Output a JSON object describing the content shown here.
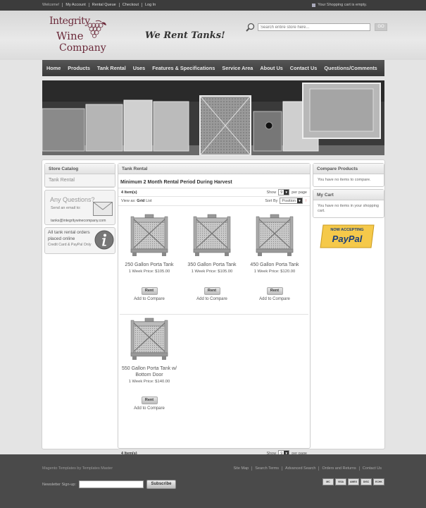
{
  "topbar": {
    "welcome": "Welcome!",
    "links": [
      "My Account",
      "Rental Queue",
      "Checkout",
      "Log In"
    ],
    "cart_status": "Your Shopping cart is empty."
  },
  "header": {
    "logo_lines": [
      "Integrity",
      "Wine",
      "Company"
    ],
    "tagline": "We Rent Tanks!",
    "search_placeholder": "Search entire store here...",
    "search_button": "GO"
  },
  "nav": {
    "items": [
      "Home",
      "Products",
      "Tank Rental",
      "Uses",
      "Features & Specifications",
      "Service Area",
      "About Us",
      "Contact Us",
      "Questions/Comments"
    ]
  },
  "sidebar": {
    "catalog_title": "Store Catalog",
    "catalog_items": [
      "Tank Rental"
    ],
    "ask": {
      "title": "Any Questions?",
      "line": "Send an email to:",
      "email": "tanks@integritywinecompany.com"
    },
    "orders": {
      "title": "All tank rental orders placed online",
      "subtitle": "Credit Card & PayPal Only"
    }
  },
  "main": {
    "title": "Tank Rental",
    "subtitle": "Minimum 2 Month Rental Period During Harvest",
    "toolbar": {
      "item_count": "4 Item(s)",
      "show_label": "Show",
      "show_value": "9",
      "per_page": "per page",
      "view_as": "View as:",
      "view_grid": "Grid",
      "view_list": "List",
      "sort_by": "Sort By",
      "sort_value": "Position"
    },
    "products": [
      {
        "name": "250 Gallon Porta Tank",
        "price": "1 Week Price: $105.00",
        "rent": "Rent",
        "compare": "Add to Compare"
      },
      {
        "name": "350 Gallon Porta Tank",
        "price": "1 Week Price: $105.00",
        "rent": "Rent",
        "compare": "Add to Compare"
      },
      {
        "name": "450 Gallon Porta Tank",
        "price": "1 Week Price: $120.00",
        "rent": "Rent",
        "compare": "Add to Compare"
      },
      {
        "name": "550 Gallon Porta Tank w/ Bottom Door",
        "price": "1 Week Price: $140.00",
        "rent": "Rent",
        "compare": "Add to Compare"
      }
    ]
  },
  "right": {
    "compare_title": "Compare Products",
    "compare_text": "You have no items to compare.",
    "cart_title": "My Cart",
    "cart_text": "You have no items in your shopping cart.",
    "paypal_top": "NOW ACCEPTING",
    "paypal_brand": "PayPal"
  },
  "footer": {
    "copyright": "Magento Templates by Templates Master",
    "links": [
      "Site Map",
      "Search Terms",
      "Advanced Search",
      "Orders and Returns",
      "Contact Us"
    ],
    "newsletter_label": "Newsletter Sign-up:",
    "subscribe": "Subscribe",
    "cards": [
      "MC",
      "VISA",
      "AMEX",
      "DISC",
      "ECHK"
    ]
  },
  "colors": {
    "brand": "#6b2a3a",
    "nav_bg": "#444444",
    "paypal_gold": "#f5c94a",
    "paypal_blue": "#1b3f7a"
  }
}
